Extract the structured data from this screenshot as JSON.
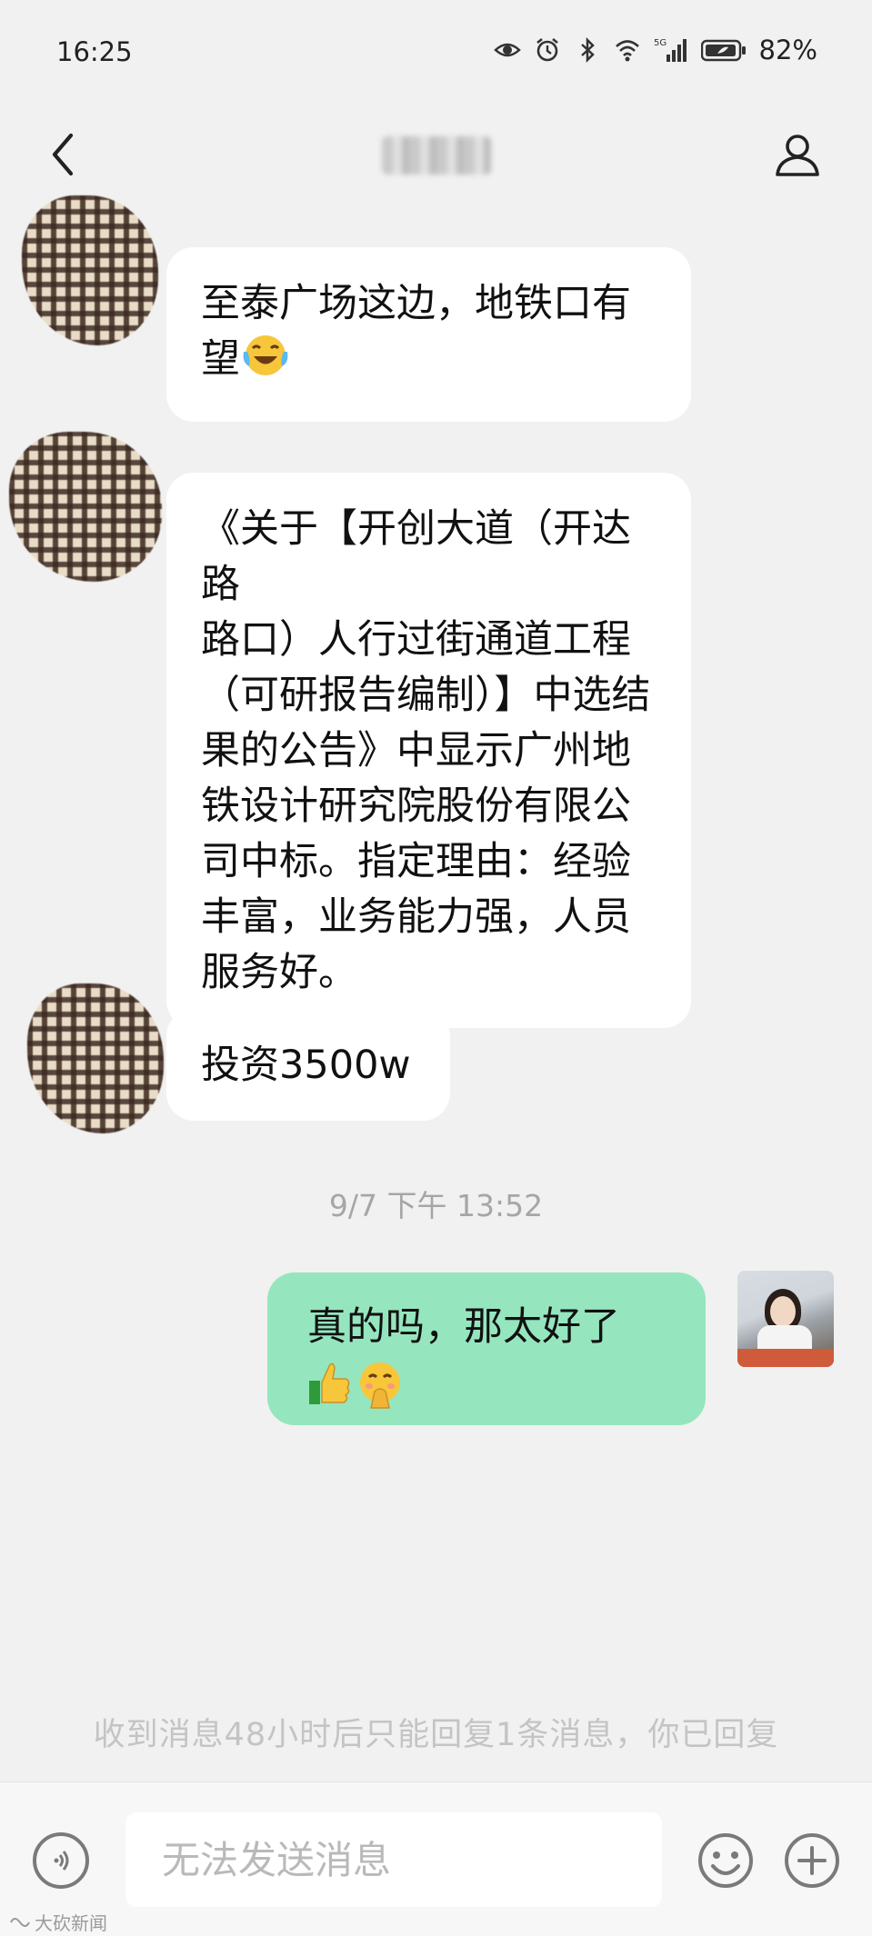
{
  "status_bar": {
    "time": "16:25",
    "network": "5G",
    "battery": "82%"
  },
  "header": {
    "contact_name": ""
  },
  "messages": [
    {
      "lines": [
        "至泰广场这边，地铁口有",
        "望"
      ],
      "emoji": "tears-of-joy-emoji"
    },
    {
      "lines": [
        "《关于【开创大道（开达路",
        "路口）人行过街通道工程",
        "（可研报告编制）】中选结",
        "果的公告》中显示广州地",
        "铁设计研究院股份有限公",
        "司中标。指定理由：经验",
        "丰富，业务能力强，人员",
        "服务好。"
      ]
    },
    {
      "lines": [
        "投资3500w"
      ]
    }
  ],
  "timestamp": "9/7 下午 13:52",
  "self_message": {
    "text": "真的吗，那太好了",
    "emojis": [
      "thumbs-up-emoji",
      "smiling-hands-emoji"
    ],
    "bubble_color": "#95e6bf"
  },
  "limit_notice": "收到消息48小时后只能回复1条消息，你已回复",
  "input": {
    "placeholder": "无法发送消息"
  },
  "watermark": "大砍新闻"
}
